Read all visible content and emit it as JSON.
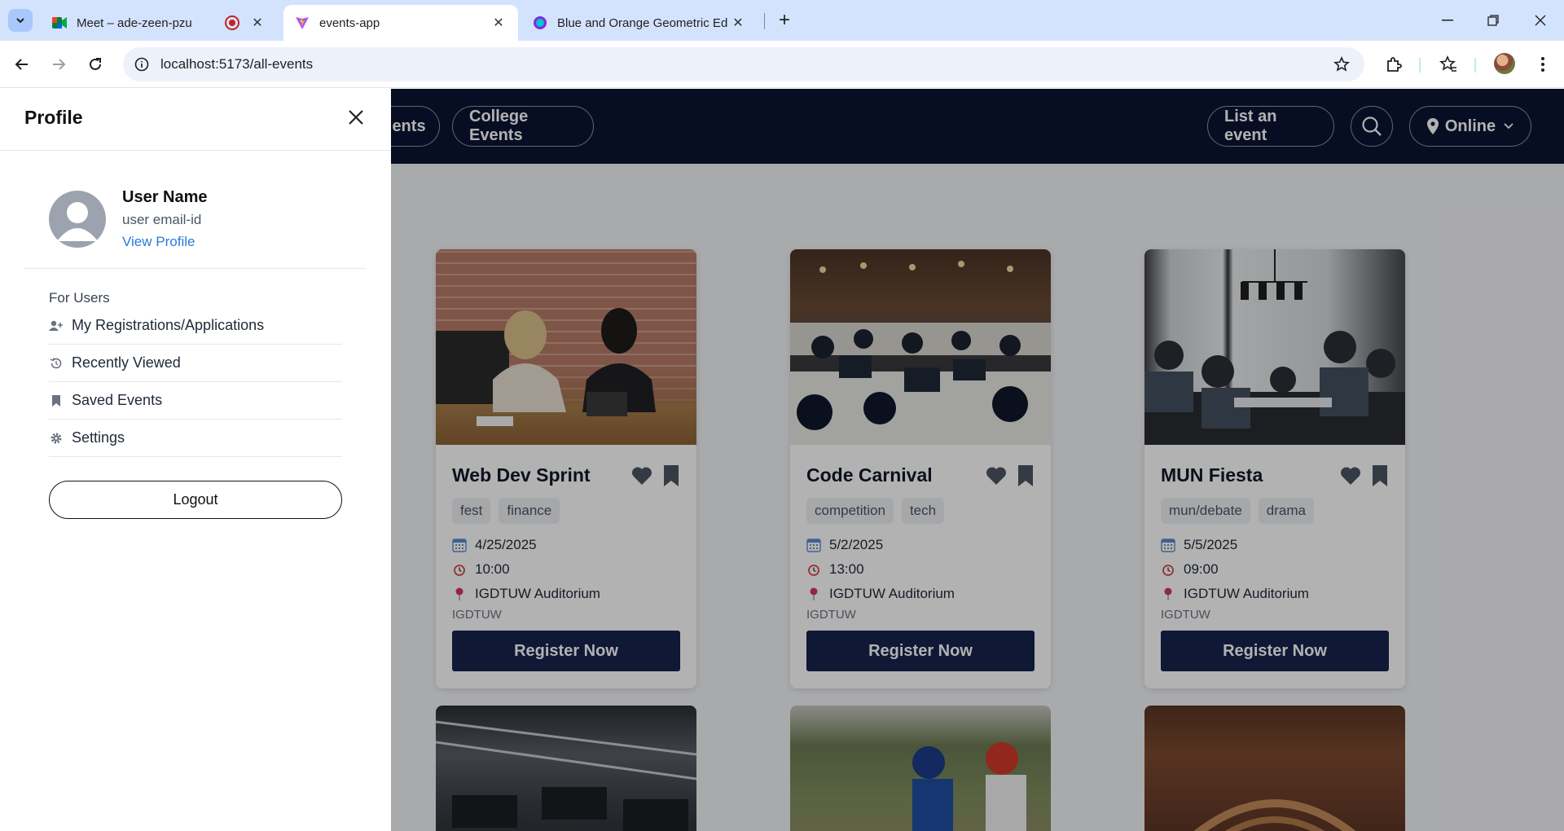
{
  "browser": {
    "tabs": [
      {
        "title": "Meet – ade-zeen-pzu",
        "favicon": "google-meet-icon",
        "active": false
      },
      {
        "title": "events-app",
        "favicon": "vite-icon",
        "active": true
      },
      {
        "title": "Blue and Orange Geometric Edu",
        "favicon": "canva-icon",
        "active": false
      }
    ],
    "url": "localhost:5173/all-events"
  },
  "header": {
    "nav_pills": [
      "ents",
      "College Events"
    ],
    "list_event": "List an event",
    "location": "Online"
  },
  "drawer": {
    "title": "Profile",
    "user_name": "User Name",
    "user_email": "user email-id",
    "view_profile": "View Profile",
    "section_label": "For Users",
    "menu": [
      {
        "label": "My Registrations/Applications",
        "icon": "user-plus-icon"
      },
      {
        "label": "Recently Viewed",
        "icon": "history-icon"
      },
      {
        "label": "Saved Events",
        "icon": "bookmark-icon"
      },
      {
        "label": "Settings",
        "icon": "gear-icon"
      }
    ],
    "logout": "Logout"
  },
  "events": [
    {
      "title": "Web Dev Sprint",
      "tags": [
        "fest",
        "finance"
      ],
      "date": "4/25/2025",
      "time": "10:00",
      "venue": "IGDTUW Auditorium",
      "org": "IGDTUW",
      "cta": "Register Now"
    },
    {
      "title": "Code Carnival",
      "tags": [
        "competition",
        "tech"
      ],
      "date": "5/2/2025",
      "time": "13:00",
      "venue": "IGDTUW Auditorium",
      "org": "IGDTUW",
      "cta": "Register Now"
    },
    {
      "title": "MUN Fiesta",
      "tags": [
        "mun/debate",
        "drama"
      ],
      "date": "5/5/2025",
      "time": "09:00",
      "venue": "IGDTUW Auditorium",
      "org": "IGDTUW",
      "cta": "Register Now"
    }
  ],
  "colors": {
    "navy": "#0b1533",
    "button": "#16234d",
    "link": "#2b7bd6"
  }
}
